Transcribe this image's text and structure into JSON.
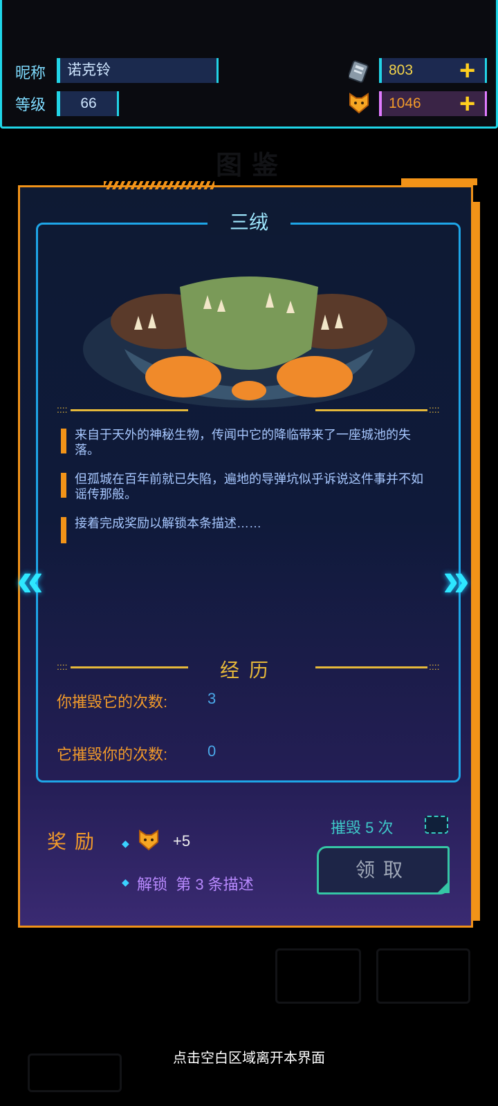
{
  "player": {
    "nickname_label": "昵称",
    "nickname": "诺克铃",
    "level_label": "等级",
    "level": "66"
  },
  "currency": [
    {
      "icon": "ticket-icon",
      "value": "803",
      "color": "#f4d44a"
    },
    {
      "icon": "cat-coin-icon",
      "value": "1046",
      "color": "#f29b2a"
    }
  ],
  "card": {
    "monster_name": "三绒",
    "descriptions": [
      "来自于天外的神秘生物，传闻中它的降临带来了一座城池的失落。",
      "但孤城在百年前就已失陷，遍地的导弹坑似乎诉说这件事并不如谣传那般。",
      "接着完成奖励以解锁本条描述……"
    ],
    "history_title": "经历",
    "history": [
      {
        "label": "你摧毁它的次数:",
        "value": "3"
      },
      {
        "label": "它摧毁你的次数:",
        "value": "0"
      }
    ],
    "reward_label": "奖励",
    "reward_amount": "+5",
    "reward_unlock": "解锁  第 3 条描述",
    "destroy_requirement": "摧毁 5 次",
    "claim_label": "领取"
  },
  "hint": "点击空白区域离开本界面",
  "colors": {
    "accent_cyan": "#1fd6e8",
    "accent_orange": "#f29318",
    "gold": "#e6b93a"
  }
}
